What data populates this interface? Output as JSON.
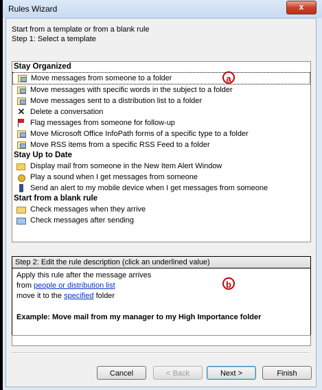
{
  "window": {
    "title": "Rules Wizard",
    "close_label": "x"
  },
  "intro": {
    "line1": "Start from a template or from a blank rule",
    "line2": "Step 1: Select a template"
  },
  "groups": {
    "stay_organized": "Stay Organized",
    "stay_up_to_date": "Stay Up to Date",
    "blank": "Start from a blank rule"
  },
  "templates": {
    "organized": [
      {
        "label": "Move messages from someone to a folder",
        "icon": "message-move-icon"
      },
      {
        "label": "Move messages with specific words in the subject to a folder",
        "icon": "message-move-icon"
      },
      {
        "label": "Move messages sent to a distribution list to a folder",
        "icon": "message-move-icon"
      },
      {
        "label": "Delete a conversation",
        "icon": "delete-x-icon"
      },
      {
        "label": "Flag messages from someone for follow-up",
        "icon": "flag-icon"
      },
      {
        "label": "Move Microsoft Office InfoPath forms of a specific type to a folder",
        "icon": "message-move-icon"
      },
      {
        "label": "Move RSS items from a specific RSS Feed to a folder",
        "icon": "message-move-icon"
      }
    ],
    "up_to_date": [
      {
        "label": "Display mail from someone in the New Item Alert Window",
        "icon": "alert-window-icon"
      },
      {
        "label": "Play a sound when I get messages from someone",
        "icon": "sound-icon"
      },
      {
        "label": "Send an alert to my mobile device when I get messages from someone",
        "icon": "mobile-phone-icon"
      }
    ],
    "blank": [
      {
        "label": "Check messages when they arrive",
        "icon": "envelope-icon"
      },
      {
        "label": "Check messages after sending",
        "icon": "send-icon"
      }
    ]
  },
  "markers": {
    "a": "a",
    "b": "b"
  },
  "step2": {
    "heading": "Step 2: Edit the rule description (click an underlined value)",
    "line1": "Apply this rule after the message arrives",
    "line2_prefix": "from ",
    "line2_link": "people or distribution list",
    "line3_prefix": "move it to the ",
    "line3_link": "specified",
    "line3_suffix": " folder",
    "example": "Example: Move mail from my manager to my High Importance folder"
  },
  "buttons": {
    "cancel": "Cancel",
    "back": "< Back",
    "next": "Next >",
    "finish": "Finish"
  },
  "colors": {
    "marker": "#c00000",
    "link": "#0033cc",
    "close": "#c7432a"
  }
}
